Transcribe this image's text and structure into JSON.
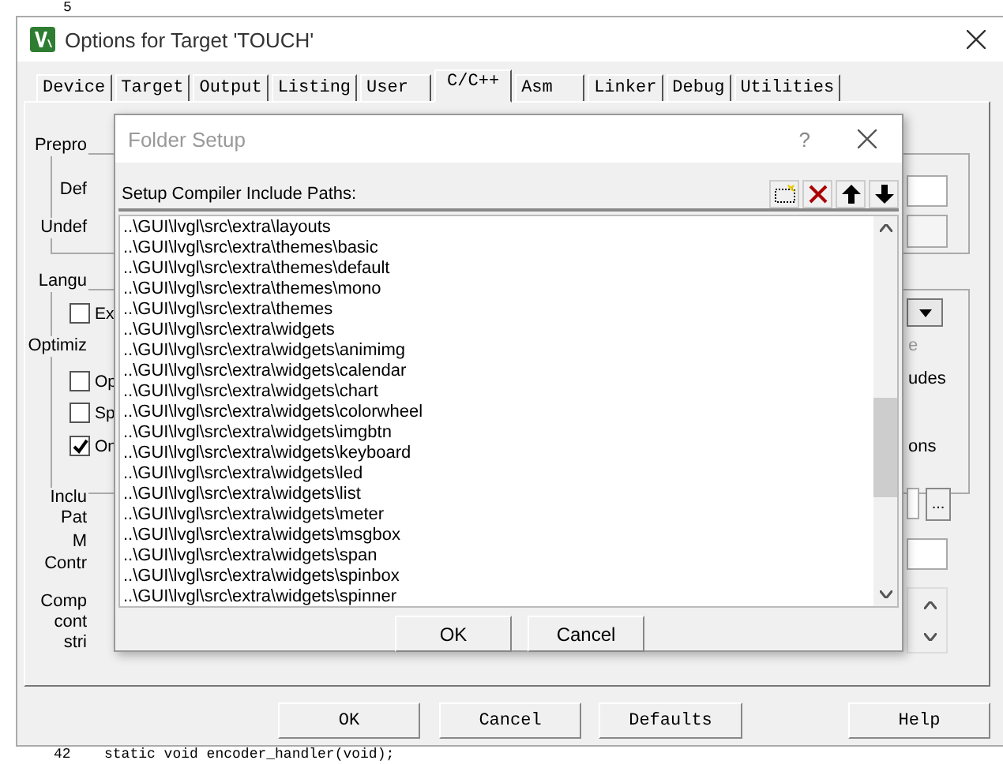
{
  "editor": {
    "top_line_number": "5",
    "bottom_line_number": "42",
    "bottom_code": "static void encoder_handler(void);"
  },
  "window": {
    "title": "Options for Target 'TOUCH'"
  },
  "tabs": [
    {
      "label": "Device",
      "selected": false
    },
    {
      "label": "Target",
      "selected": false
    },
    {
      "label": "Output",
      "selected": false
    },
    {
      "label": "Listing",
      "selected": false
    },
    {
      "label": "User",
      "selected": false
    },
    {
      "label": "C/C++",
      "selected": true
    },
    {
      "label": "Asm",
      "selected": false
    },
    {
      "label": "Linker",
      "selected": false
    },
    {
      "label": "Debug",
      "selected": false
    },
    {
      "label": "Utilities",
      "selected": false
    }
  ],
  "panel": {
    "groups": [
      "Prepro",
      "Langu"
    ],
    "labels": [
      "Def",
      "Undef",
      "Optimiz",
      "Inclu",
      "Pat",
      "M",
      "Contr",
      "Comp",
      "cont",
      "stri"
    ],
    "checkboxes": [
      {
        "label": "Ex",
        "checked": false
      },
      {
        "label": "Op",
        "checked": false
      },
      {
        "label": "Sp",
        "checked": false
      },
      {
        "label": "On",
        "checked": true
      }
    ],
    "right_labels": [
      {
        "text": "e",
        "disabled": true
      },
      {
        "text": "udes",
        "disabled": false
      },
      {
        "text": "ons",
        "disabled": false
      }
    ],
    "browse_button": "..."
  },
  "buttons": [
    "OK",
    "Cancel",
    "Defaults",
    "Help"
  ],
  "folder_setup": {
    "title": "Folder Setup",
    "help": "?",
    "header": "Setup Compiler Include Paths:",
    "paths": [
      "..\\GUI\\lvgl\\src\\extra\\layouts",
      "..\\GUI\\lvgl\\src\\extra\\themes\\basic",
      "..\\GUI\\lvgl\\src\\extra\\themes\\default",
      "..\\GUI\\lvgl\\src\\extra\\themes\\mono",
      "..\\GUI\\lvgl\\src\\extra\\themes",
      "..\\GUI\\lvgl\\src\\extra\\widgets",
      "..\\GUI\\lvgl\\src\\extra\\widgets\\animimg",
      "..\\GUI\\lvgl\\src\\extra\\widgets\\calendar",
      "..\\GUI\\lvgl\\src\\extra\\widgets\\chart",
      "..\\GUI\\lvgl\\src\\extra\\widgets\\colorwheel",
      "..\\GUI\\lvgl\\src\\extra\\widgets\\imgbtn",
      "..\\GUI\\lvgl\\src\\extra\\widgets\\keyboard",
      "..\\GUI\\lvgl\\src\\extra\\widgets\\led",
      "..\\GUI\\lvgl\\src\\extra\\widgets\\list",
      "..\\GUI\\lvgl\\src\\extra\\widgets\\meter",
      "..\\GUI\\lvgl\\src\\extra\\widgets\\msgbox",
      "..\\GUI\\lvgl\\src\\extra\\widgets\\span",
      "..\\GUI\\lvgl\\src\\extra\\widgets\\spinbox",
      "..\\GUI\\lvgl\\src\\extra\\widgets\\spinner"
    ],
    "buttons": [
      "OK",
      "Cancel"
    ]
  }
}
